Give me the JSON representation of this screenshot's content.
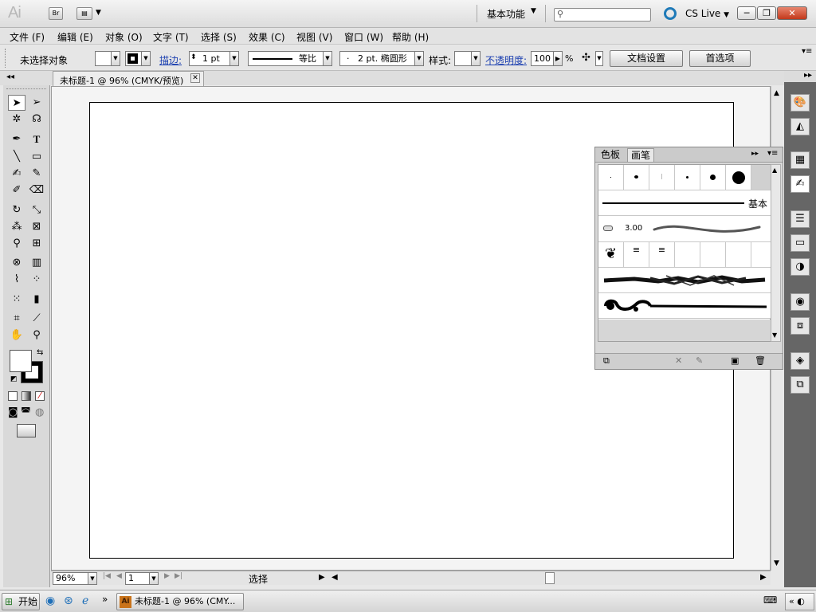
{
  "app": {
    "logo": "Ai",
    "bridge_label": "Br",
    "workspace": "基本功能",
    "cs_live": "CS Live"
  },
  "menu": [
    "文件 (F)",
    "编辑 (E)",
    "对象 (O)",
    "文字 (T)",
    "选择 (S)",
    "效果 (C)",
    "视图 (V)",
    "窗口 (W)",
    "帮助 (H)"
  ],
  "control": {
    "no_selection": "未选择对象",
    "stroke_label": "描边:",
    "stroke_value": "1 pt",
    "stroke_profile": "等比",
    "brush_def": "2 pt. 椭圆形",
    "brush_dot": "·",
    "style_label": "样式:",
    "opacity_label": "不透明度:",
    "opacity_value": "100",
    "opacity_unit": "%",
    "doc_setup": "文档设置",
    "preferences": "首选项"
  },
  "document": {
    "tab_title": "未标题-1 @ 96% (CMYK/预览)",
    "zoom": "96%",
    "page": "1",
    "status": "选择"
  },
  "brush_panel": {
    "tabs": [
      "色板",
      "画笔"
    ],
    "active_tab": "画笔",
    "basic_label": "基本",
    "art_size": "3.00"
  },
  "taskbar": {
    "start": "开始",
    "task": "未标题-1 @ 96% (CMY..."
  }
}
